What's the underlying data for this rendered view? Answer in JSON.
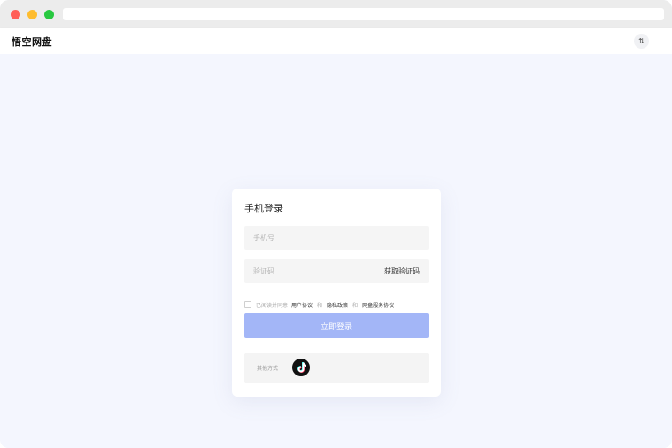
{
  "browser": {
    "traffic_lights": {
      "close": "#ff5f57",
      "minimize": "#febc2e",
      "zoom": "#28c840"
    }
  },
  "header": {
    "brand": "悟空网盘",
    "sort_icon": "⇅"
  },
  "login": {
    "title": "手机登录",
    "phone_placeholder": "手机号",
    "code_placeholder": "验证码",
    "get_code_label": "获取验证码",
    "agree": {
      "prefix": "已阅读并同意",
      "user_agreement": "用户协议",
      "sep1": "和",
      "privacy_policy": "隐私政策",
      "sep2": "和",
      "service_agreement": "网盘服务协议"
    },
    "submit_label": "立即登录",
    "other_methods_label": "其他方式",
    "other_method_icon": "tiktok-icon"
  },
  "colors": {
    "page_background": "#f4f6fe",
    "primary_button": "#a3b6f7"
  }
}
